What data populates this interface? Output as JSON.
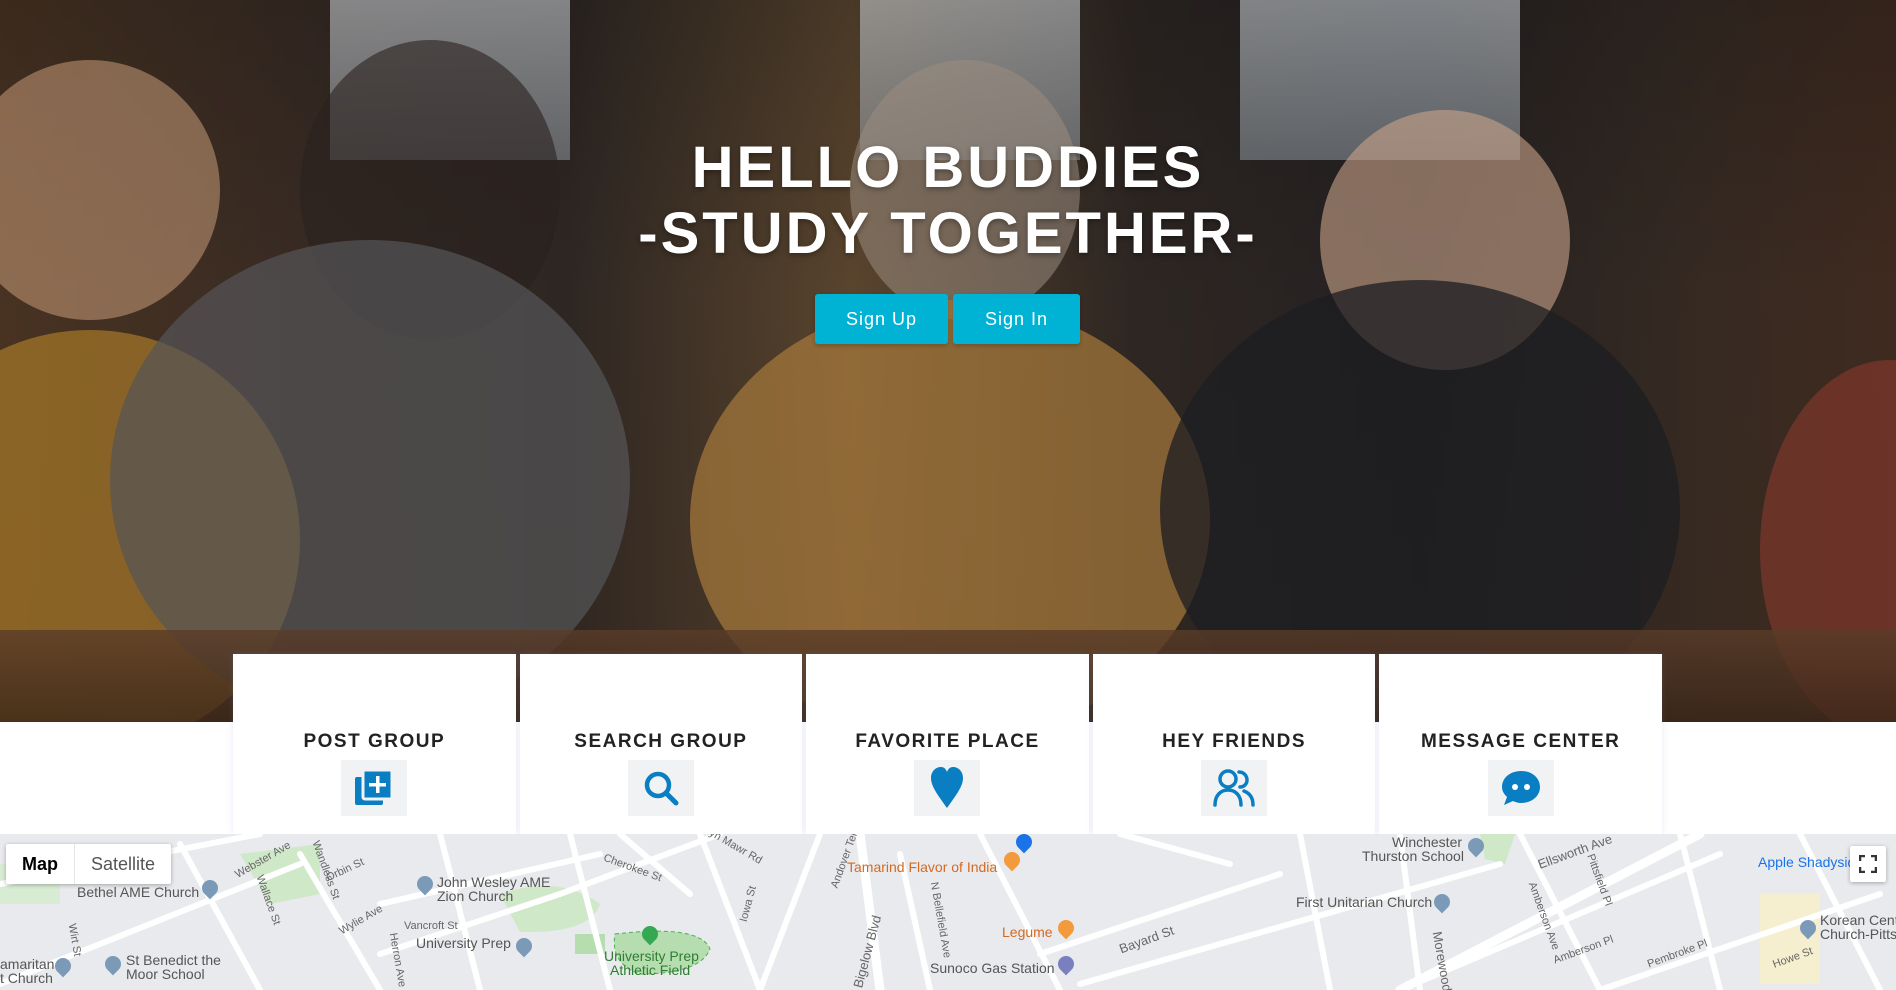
{
  "hero": {
    "title_line1": "HELLO BUDDIES",
    "title_line2": "-STUDY TOGETHER-",
    "signup_label": "Sign Up",
    "signin_label": "Sign In"
  },
  "features": [
    {
      "label": "POST GROUP",
      "icon": "add-box-icon"
    },
    {
      "label": "SEARCH GROUP",
      "icon": "search-icon"
    },
    {
      "label": "FAVORITE PLACE",
      "icon": "heart-icon"
    },
    {
      "label": "HEY FRIENDS",
      "icon": "people-icon"
    },
    {
      "label": "MESSAGE CENTER",
      "icon": "chat-bubble-icon"
    }
  ],
  "map": {
    "type_map": "Map",
    "type_satellite": "Satellite",
    "places": {
      "bethel": "Bethel AME Church",
      "john_wesley_1": "John Wesley AME",
      "john_wesley_2": "Zion Church",
      "university_prep": "University Prep",
      "upaf_1": "University Prep",
      "upaf_2": "Athletic Field",
      "st_benedict_1": "St Benedict the",
      "st_benedict_2": "Moor School",
      "samaritan_1": "amaritan",
      "samaritan_2": "t Church",
      "tamarind": "Tamarind Flavor of India",
      "legume": "Legume",
      "sunoco": "Sunoco Gas Station",
      "winchester_1": "Winchester",
      "winchester_2": "Thurston School",
      "first_unitarian": "First Unitarian Church",
      "apple": "Apple Shadysid",
      "korean_1": "Korean Cent",
      "korean_2": "Church-Pitts"
    },
    "roads": {
      "webster": "Webster Ave",
      "wandless": "Wandless St",
      "orbin": "Orbin St",
      "wallace": "Wallace St",
      "wylie": "Wylie Ave",
      "herron": "Herron Ave",
      "vancroft": "Vancroft St",
      "cherokee": "Cherokee St",
      "bryn_mawr": "Bryn Mawr Rd",
      "iowa": "Iowa St",
      "andover": "Andover Ter",
      "bigelow": "Bigelow Blvd",
      "bellefield": "N Bellefield Ave",
      "bayard": "Bayard St",
      "ellsworth": "Ellsworth Ave",
      "amberson": "Amberson Ave",
      "amberson_pl": "Amberson Pl",
      "pembroke": "Pembroke Pl",
      "morewood": "Morewood",
      "pittsfield": "Pittsfield Pl",
      "howe": "Howe St",
      "wirt": "Wirt St"
    }
  }
}
